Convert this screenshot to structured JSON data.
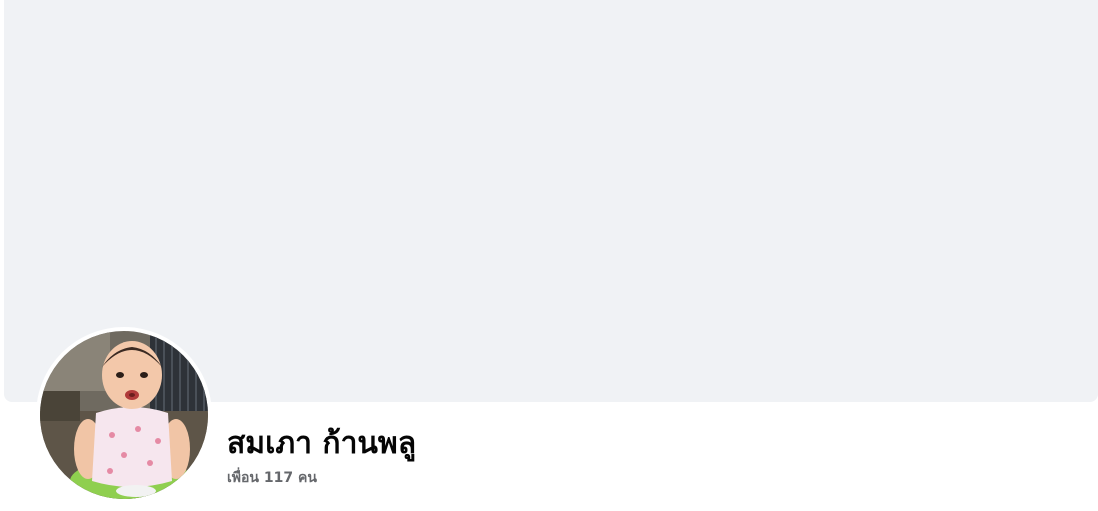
{
  "profile": {
    "name": "สมเภา ก้านพลู",
    "friends_text": "เพื่อน 117 คน"
  },
  "colors": {
    "cover_background": "#f0f2f5",
    "name_text": "#050505",
    "secondary_text": "#65676b"
  }
}
